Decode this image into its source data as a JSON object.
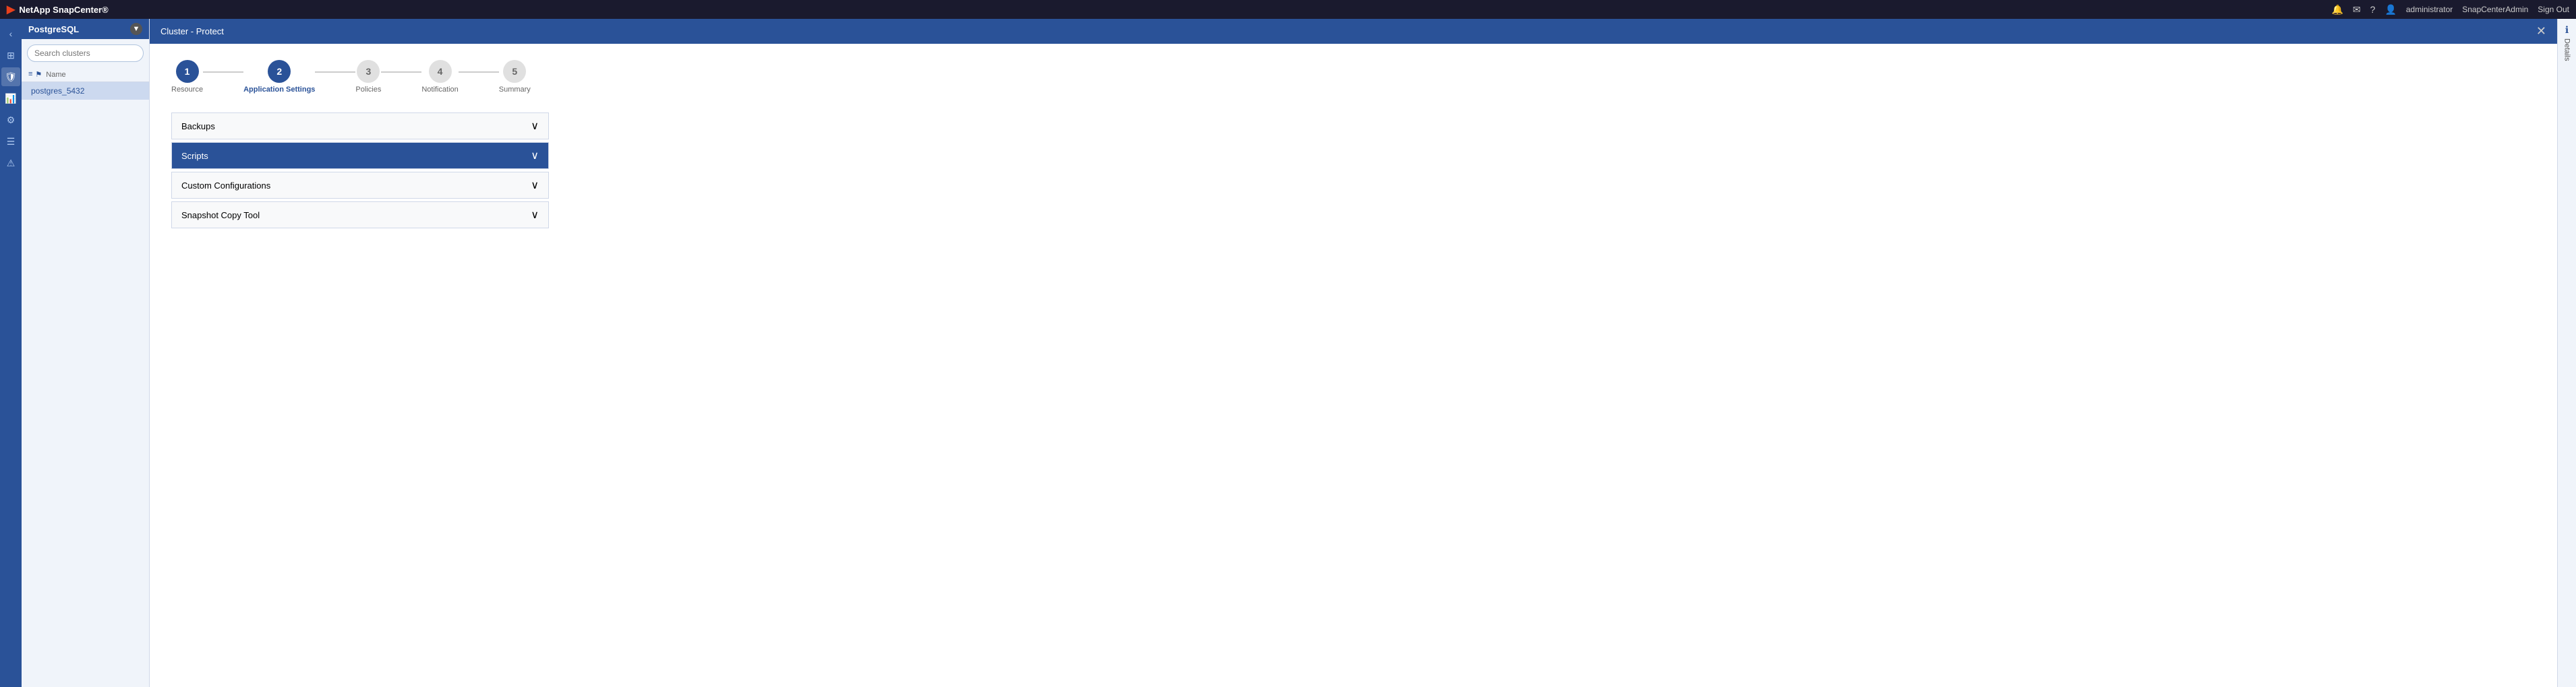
{
  "topbar": {
    "logo_icon": "▶",
    "brand": "NetApp SnapCenter®",
    "notifications_icon": "🔔",
    "mail_icon": "✉",
    "help_icon": "?",
    "user_icon": "👤",
    "username": "administrator",
    "instance": "SnapCenterAdmin",
    "signout": "Sign Out"
  },
  "sidebar": {
    "db_type": "PostgreSQL",
    "search_placeholder": "Search clusters",
    "col_label": "Name",
    "items": [
      {
        "name": "postgres_5432",
        "selected": true
      }
    ]
  },
  "content_header": {
    "breadcrumb": "Cluster - Protect",
    "close_label": "✕"
  },
  "wizard": {
    "steps": [
      {
        "number": "1",
        "label": "Resource",
        "state": "completed"
      },
      {
        "number": "2",
        "label": "Application Settings",
        "state": "active"
      },
      {
        "number": "3",
        "label": "Policies",
        "state": "inactive"
      },
      {
        "number": "4",
        "label": "Notification",
        "state": "inactive"
      },
      {
        "number": "5",
        "label": "Summary",
        "state": "inactive"
      }
    ]
  },
  "accordion": {
    "sections": [
      {
        "id": "backups",
        "label": "Backups",
        "expanded": false
      },
      {
        "id": "scripts",
        "label": "Scripts",
        "expanded": true
      },
      {
        "id": "custom-configurations",
        "label": "Custom Configurations",
        "expanded": false
      },
      {
        "id": "snapshot-copy-tool",
        "label": "Snapshot Copy Tool",
        "expanded": false
      }
    ]
  },
  "details_panel": {
    "label": "Details"
  },
  "rail": {
    "icons": [
      {
        "name": "chevron-left",
        "symbol": "‹"
      },
      {
        "name": "apps",
        "symbol": "⊞"
      },
      {
        "name": "shield",
        "symbol": "🛡"
      },
      {
        "name": "chart",
        "symbol": "📊"
      },
      {
        "name": "nodes",
        "symbol": "⚙"
      },
      {
        "name": "list",
        "symbol": "☰"
      },
      {
        "name": "alert",
        "symbol": "⚠"
      }
    ]
  }
}
